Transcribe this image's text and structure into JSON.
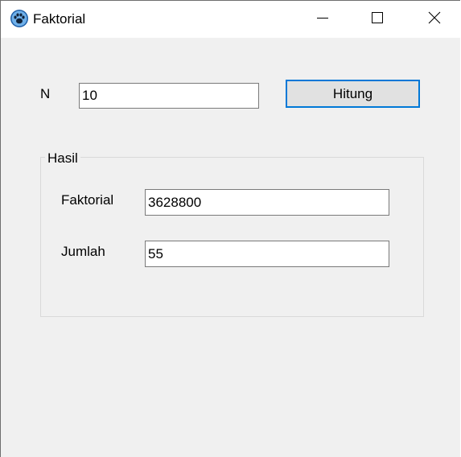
{
  "window": {
    "title": "Faktorial",
    "icon": "paw-icon",
    "controls": {
      "minimize_icon": "minimize-icon",
      "maximize_icon": "maximize-icon",
      "close_icon": "close-icon"
    }
  },
  "form": {
    "n_label": "N",
    "n_value": "10",
    "calculate_label": "Hitung"
  },
  "result": {
    "group_title": "Hasil",
    "factorial_label": "Faktorial",
    "factorial_value": "3628800",
    "sum_label": "Jumlah",
    "sum_value": "55"
  },
  "colors": {
    "accent": "#0078d7",
    "window_bg": "#f0f0f0",
    "titlebar_bg": "#ffffff"
  }
}
